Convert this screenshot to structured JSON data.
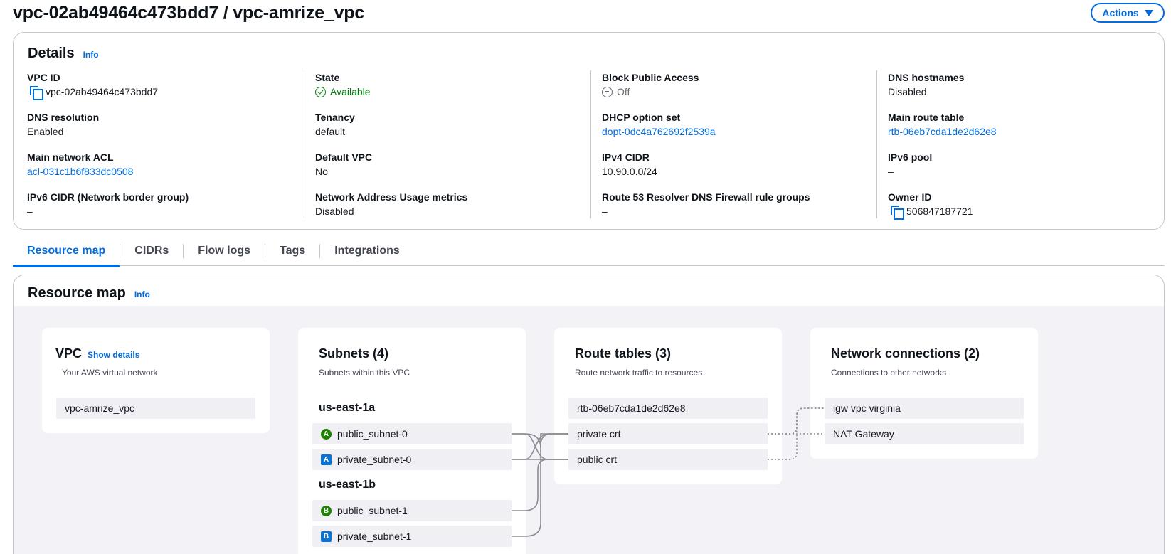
{
  "page": {
    "title": "vpc-02ab49464c473bdd7 / vpc-amrize_vpc",
    "actions_label": "Actions"
  },
  "details": {
    "title": "Details",
    "info": "Info",
    "columns": [
      [
        {
          "label": "VPC ID",
          "value": "vpc-02ab49464c473bdd7",
          "kind": "copy"
        },
        {
          "label": "DNS resolution",
          "value": "Enabled",
          "kind": "text"
        },
        {
          "label": "Main network ACL",
          "value": "acl-031c1b6f833dc0508",
          "kind": "link"
        },
        {
          "label": "IPv6 CIDR (Network border group)",
          "value": "–",
          "kind": "text"
        }
      ],
      [
        {
          "label": "State",
          "value": "Available",
          "kind": "status"
        },
        {
          "label": "Tenancy",
          "value": "default",
          "kind": "text"
        },
        {
          "label": "Default VPC",
          "value": "No",
          "kind": "text"
        },
        {
          "label": "Network Address Usage metrics",
          "value": "Disabled",
          "kind": "text"
        }
      ],
      [
        {
          "label": "Block Public Access",
          "value": "Off",
          "kind": "off"
        },
        {
          "label": "DHCP option set",
          "value": "dopt-0dc4a762692f2539a",
          "kind": "link"
        },
        {
          "label": "IPv4 CIDR",
          "value": "10.90.0.0/24",
          "kind": "text"
        },
        {
          "label": "Route 53 Resolver DNS Firewall rule groups",
          "value": "–",
          "kind": "text"
        }
      ],
      [
        {
          "label": "DNS hostnames",
          "value": "Disabled",
          "kind": "text"
        },
        {
          "label": "Main route table",
          "value": "rtb-06eb7cda1de2d62e8",
          "kind": "link"
        },
        {
          "label": "IPv6 pool",
          "value": "–",
          "kind": "text"
        },
        {
          "label": "Owner ID",
          "value": "506847187721",
          "kind": "copy"
        }
      ]
    ]
  },
  "tabs": [
    "Resource map",
    "CIDRs",
    "Flow logs",
    "Tags",
    "Integrations"
  ],
  "resource_map": {
    "title": "Resource map",
    "info": "Info",
    "vpc": {
      "title": "VPC",
      "show_details": "Show details",
      "subtitle": "Your AWS virtual network",
      "name": "vpc-amrize_vpc"
    },
    "subnets": {
      "title": "Subnets (4)",
      "subtitle": "Subnets within this VPC",
      "zones": [
        {
          "name": "us-east-1a",
          "items": [
            {
              "badge": "A",
              "type": "public",
              "name": "public_subnet-0"
            },
            {
              "badge": "A",
              "type": "private",
              "name": "private_subnet-0"
            }
          ]
        },
        {
          "name": "us-east-1b",
          "items": [
            {
              "badge": "B",
              "type": "public",
              "name": "public_subnet-1"
            },
            {
              "badge": "B",
              "type": "private",
              "name": "private_subnet-1"
            }
          ]
        }
      ]
    },
    "route_tables": {
      "title": "Route tables (3)",
      "subtitle": "Route network traffic to resources",
      "items": [
        "rtb-06eb7cda1de2d62e8",
        "private crt",
        "public crt"
      ]
    },
    "network_connections": {
      "title": "Network connections (2)",
      "subtitle": "Connections to other networks",
      "items": [
        "igw vpc virginia",
        "NAT Gateway"
      ]
    }
  },
  "colors": {
    "accent": "#006ce0",
    "status_ok": "#037f0c",
    "public_badge": "#1d8102",
    "private_badge": "#0972d3"
  }
}
